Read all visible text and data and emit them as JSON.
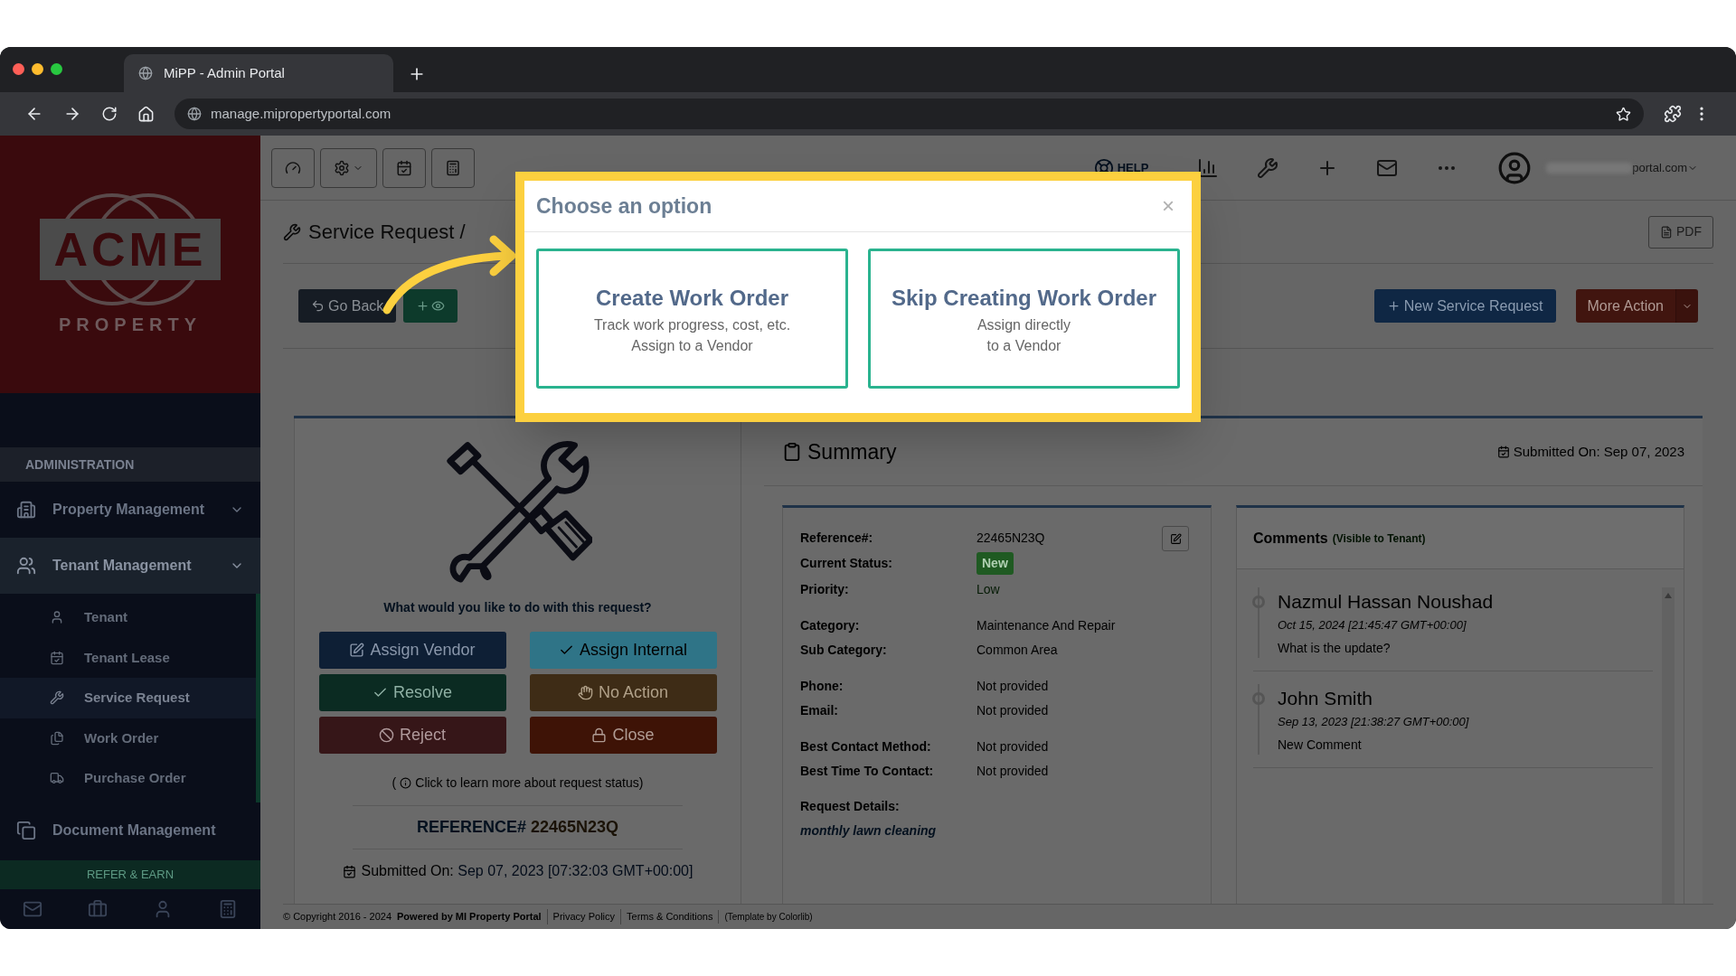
{
  "browser": {
    "tab_title": "MiPP - Admin Portal",
    "url": "manage.mipropertyportal.com"
  },
  "sidebar": {
    "logo": {
      "name": "ACME",
      "sub": "PROPERTY"
    },
    "section": "ADMINISTRATION",
    "items": [
      {
        "label": "Property Management",
        "kind": "building",
        "selected": false
      },
      {
        "label": "Tenant Management",
        "kind": "users",
        "selected": true,
        "children": [
          {
            "label": "Tenant",
            "kind": "user",
            "selected": false
          },
          {
            "label": "Tenant Lease",
            "kind": "calendar",
            "selected": false
          },
          {
            "label": "Service Request",
            "kind": "wrench",
            "selected": true
          },
          {
            "label": "Work Order",
            "kind": "files",
            "selected": false
          },
          {
            "label": "Purchase Order",
            "kind": "truck",
            "selected": false
          }
        ]
      },
      {
        "label": "Document Management",
        "kind": "copy",
        "selected": false
      }
    ],
    "refer": "REFER & EARN"
  },
  "topbar": {
    "help": "HELP",
    "user_email": "portal.com"
  },
  "page": {
    "breadcrumb": "Service Request /",
    "pdf": "PDF",
    "go_back": "Go Back",
    "new_request": "New Service Request",
    "more_action": "More Action"
  },
  "actions": {
    "prompt": "What would you like to do with this request?",
    "buttons": [
      {
        "label": "Assign Vendor",
        "kind": "assign-vendor"
      },
      {
        "label": "Assign Internal",
        "kind": "assign-internal"
      },
      {
        "label": "Resolve",
        "kind": "resolve"
      },
      {
        "label": "No Action",
        "kind": "no-action"
      },
      {
        "label": "Reject",
        "kind": "reject"
      },
      {
        "label": "Close",
        "kind": "close"
      }
    ],
    "learn_more_open": "(",
    "learn_more": "Click to learn more about request status)",
    "reference_label": "REFERENCE#",
    "reference_value": "22465N23Q",
    "submitted_label": "Submitted On:",
    "submitted_value": "Sep 07, 2023 [07:32:03 GMT+00:00]"
  },
  "summary": {
    "title": "Summary",
    "submitted_label": "Submitted On:",
    "submitted_value": "Sep 07, 2023",
    "field_groups": [
      [
        {
          "label": "Reference#:",
          "value": "22465N23Q"
        },
        {
          "label": "Current Status:",
          "value": "New",
          "kind": "badge"
        },
        {
          "label": "Priority:",
          "value": "Low",
          "kind": "priority"
        }
      ],
      [
        {
          "label": "Category:",
          "value": "Maintenance And Repair"
        },
        {
          "label": "Sub Category:",
          "value": "Common Area"
        }
      ],
      [
        {
          "label": "Phone:",
          "value": "Not provided"
        },
        {
          "label": "Email:",
          "value": "Not provided"
        }
      ],
      [
        {
          "label": "Best Contact Method:",
          "value": "Not provided"
        },
        {
          "label": "Best Time To Contact:",
          "value": "Not provided"
        }
      ]
    ],
    "details_label": "Request Details:",
    "details_value": "monthly lawn cleaning"
  },
  "comments": {
    "title": "Comments",
    "note": "(Visible to Tenant)",
    "items": [
      {
        "author": "Nazmul Hassan Noushad",
        "time": "Oct 15, 2024 [21:45:47 GMT+00:00]",
        "text": "What is the update?"
      },
      {
        "author": "John Smith",
        "time": "Sep 13, 2023 [21:38:27 GMT+00:00]",
        "text": "New Comment"
      }
    ]
  },
  "footer": {
    "copyright": "© Copyright 2016 - 2024",
    "powered": "Powered by MI Property Portal",
    "privacy": "Privacy Policy",
    "terms": "Terms & Conditions",
    "template": "(Template by Colorlib)"
  },
  "modal": {
    "title": "Choose an option",
    "close": "×",
    "options": [
      {
        "title": "Create Work Order",
        "lines": [
          "Track work progress, cost, etc.",
          "Assign to a Vendor"
        ]
      },
      {
        "title": "Skip Creating Work Order",
        "lines": [
          "Assign directly",
          "to a Vendor"
        ]
      }
    ]
  }
}
